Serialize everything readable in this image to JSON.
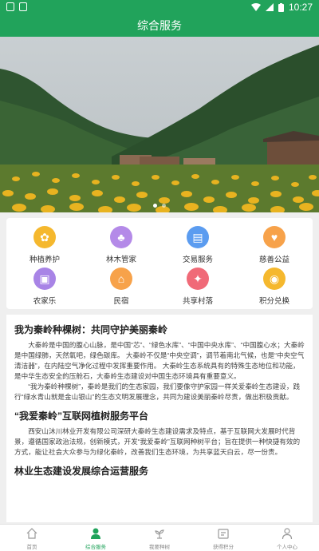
{
  "status": {
    "time": "10:27"
  },
  "app_bar": {
    "title": "综合服务"
  },
  "banner": {
    "slides": 2,
    "active_index": 0
  },
  "services": [
    {
      "label": "种植养护",
      "icon": "sprout-icon",
      "color": "#f5b82e"
    },
    {
      "label": "林木管家",
      "icon": "tree-icon",
      "color": "#b48ae8"
    },
    {
      "label": "交易服务",
      "icon": "ticket-icon",
      "color": "#5b9cf0"
    },
    {
      "label": "慈善公益",
      "icon": "heart-icon",
      "color": "#f7a24a"
    },
    {
      "label": "农家乐",
      "icon": "bus-icon",
      "color": "#a884e6"
    },
    {
      "label": "民宿",
      "icon": "house-icon",
      "color": "#f7a24a"
    },
    {
      "label": "共享村落",
      "icon": "share-icon",
      "color": "#f06a78"
    },
    {
      "label": "积分兑换",
      "icon": "coins-icon",
      "color": "#f5b82e"
    }
  ],
  "article": {
    "sections": [
      {
        "heading": "我为秦岭种棵树：共同守护美丽秦岭",
        "paragraphs": [
          "大秦岭是中国的腹心山脉，是中国“芯”、“绿色水库”、“中国中央水库”、“中国腹心水；大秦岭是中国绿肺，天然氧吧，绿色碳库。 大秦岭不仅是“中央空调”，调节着南北气候，也是“中央空气清洁器”，在内陆空气净化过程中发挥重要作用。 大秦岭生态系统具有的特殊生态地位和功能，是中华生态安全的压舱石，大秦岭生态建设对中国生态环境具有重要意义。",
          "“我为秦岭种棵树”，秦岭是我们的生态家园，我们要像守护家园一样关爱秦岭生态建设，践行“绿水青山就是金山银山”的生态文明发展理念，共同为建设美丽秦岭尽责，做出积极贡献。"
        ]
      },
      {
        "heading": "“我爱秦岭”互联网植树服务平台",
        "paragraphs": [
          "西安山沐川林业开发有限公司深研大秦岭生态建设需求及特点，基于互联网大发展时代背景，遵循国家政治法规，创新模式，开发“我爱秦岭”互联网种树平台；旨在提供一种快捷有效的方式，能让社会大众参与为绿化秦岭，改善我们生态环境，为共享蓝天白云，尽一份责。"
        ]
      },
      {
        "heading": "林业生态建设发展综合运营服务",
        "paragraphs": []
      }
    ]
  },
  "tabs": [
    {
      "label": "首页",
      "icon": "home-icon"
    },
    {
      "label": "综合服务",
      "icon": "service-icon",
      "active": true
    },
    {
      "label": "我要种树",
      "icon": "plant-icon"
    },
    {
      "label": "获得积分",
      "icon": "points-icon"
    },
    {
      "label": "个人中心",
      "icon": "user-icon"
    }
  ]
}
